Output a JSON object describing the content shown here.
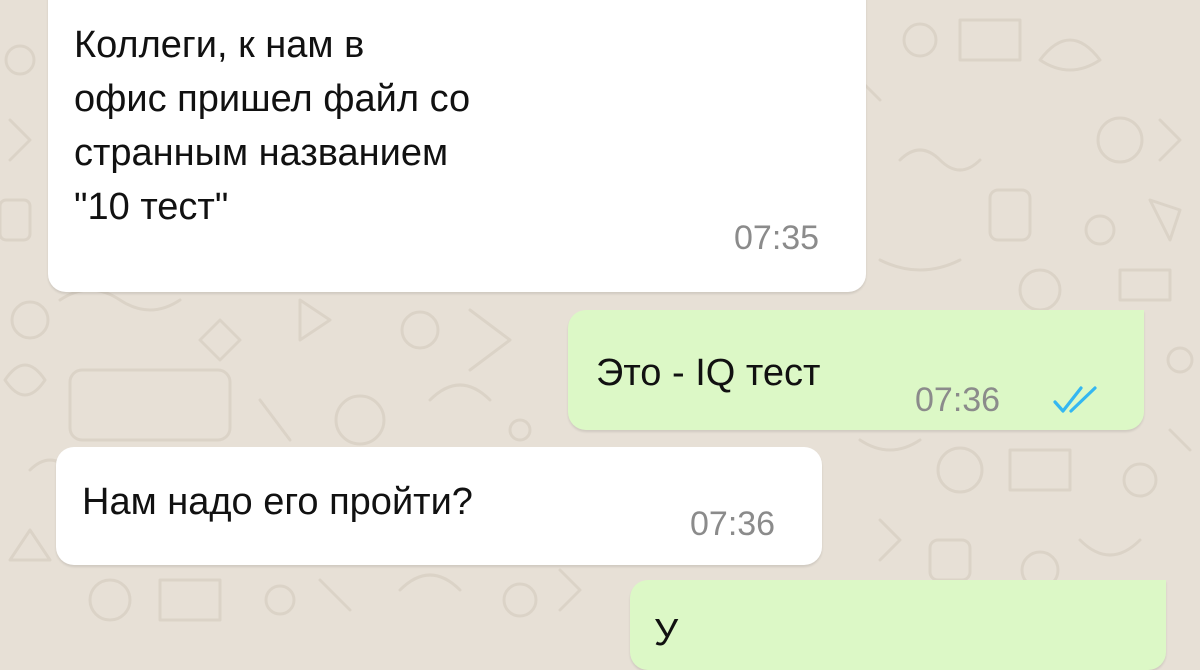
{
  "chat": {
    "messages": [
      {
        "direction": "incoming",
        "text": "Коллеги, к нам в\nофис пришел файл со\nстранным названием\n\"10 тест\"",
        "time": "07:35"
      },
      {
        "direction": "outgoing",
        "text": "Это - IQ тест",
        "time": "07:36",
        "status_icon": "double-check-read-icon",
        "status_color": "#34b7f1"
      },
      {
        "direction": "incoming",
        "text": "Нам надо его пройти?",
        "time": "07:36"
      },
      {
        "direction": "outgoing",
        "text": "У"
      }
    ]
  },
  "colors": {
    "wallpaper": "#e7e0d6",
    "incoming_bubble": "#ffffff",
    "outgoing_bubble": "#dcf8c6",
    "timestamp": "#8b8b8b",
    "read_ticks": "#34b7f1"
  }
}
